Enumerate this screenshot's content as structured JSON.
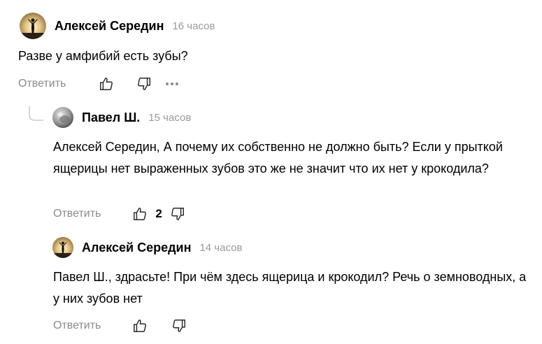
{
  "comments": [
    {
      "author": "Алексей Середин",
      "time": "16 часов",
      "text": "Разве у амфибий есть зубы?",
      "reply_label": "Ответить",
      "avatar": "sunset-silhouette"
    },
    {
      "author": "Павел Ш.",
      "time": "15 часов",
      "text": "Алексей Середин, А почему их собственно не должно быть? Если у прыткой ящерицы нет выраженных зубов это же не значит что их нет у крокодила?",
      "reply_label": "Ответить",
      "likes": "2",
      "avatar": "gray-round"
    },
    {
      "author": "Алексей Середин",
      "time": "14 часов",
      "text": "Павел Ш., здрасьте! При чём здесь ящерица и крокодил? Речь о земноводных, а у них зубов нет",
      "reply_label": "Ответить",
      "avatar": "sunset-silhouette"
    }
  ],
  "icons": {
    "like": "thumbs-up-icon",
    "dislike": "thumbs-down-icon",
    "more": "more-dots-icon",
    "thread": "reply-thread-icon"
  },
  "colors": {
    "muted": "#8a8a8a",
    "time": "#999999",
    "text": "#000000"
  }
}
